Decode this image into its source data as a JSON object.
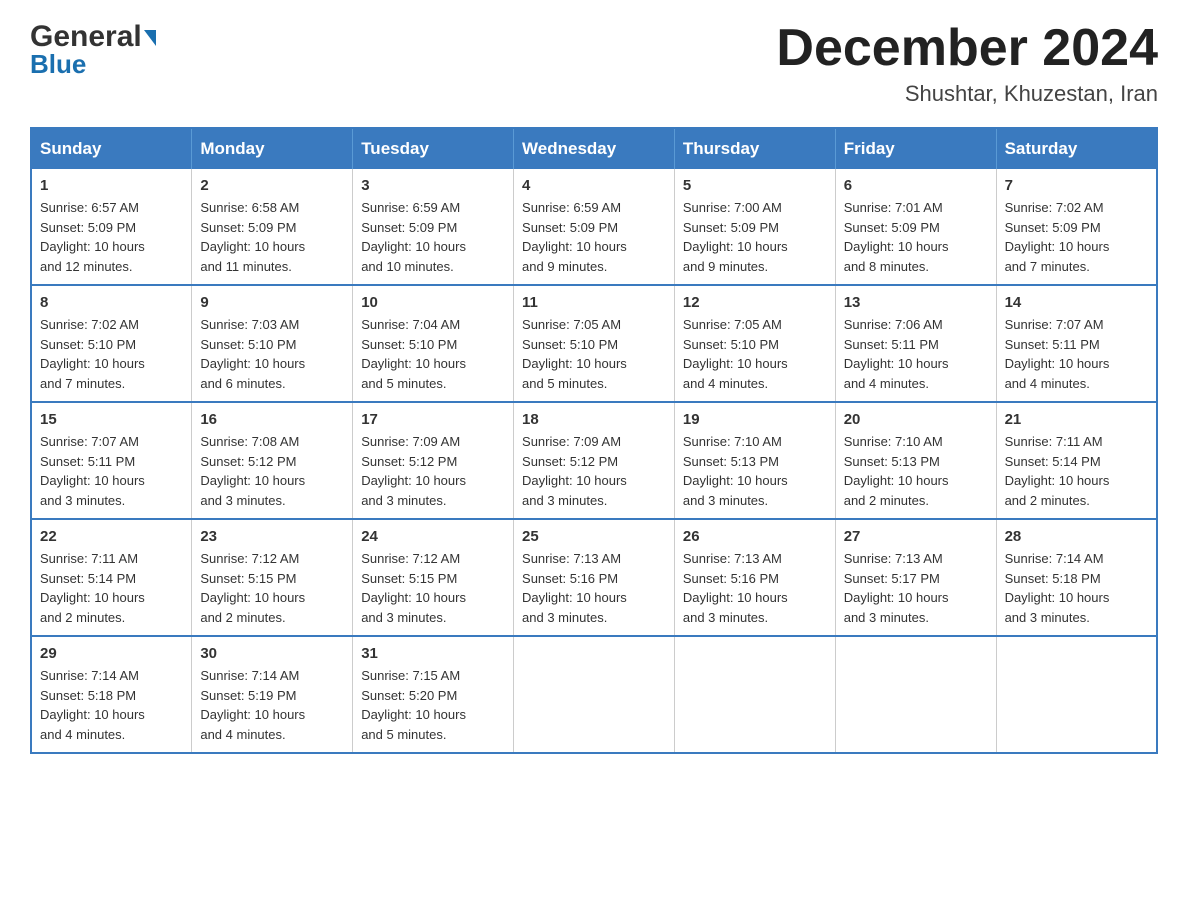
{
  "header": {
    "logo_line1": "General",
    "logo_line2": "Blue",
    "month": "December 2024",
    "location": "Shushtar, Khuzestan, Iran"
  },
  "weekdays": [
    "Sunday",
    "Monday",
    "Tuesday",
    "Wednesday",
    "Thursday",
    "Friday",
    "Saturday"
  ],
  "weeks": [
    [
      {
        "day": "1",
        "sunrise": "6:57 AM",
        "sunset": "5:09 PM",
        "daylight": "10 hours and 12 minutes."
      },
      {
        "day": "2",
        "sunrise": "6:58 AM",
        "sunset": "5:09 PM",
        "daylight": "10 hours and 11 minutes."
      },
      {
        "day": "3",
        "sunrise": "6:59 AM",
        "sunset": "5:09 PM",
        "daylight": "10 hours and 10 minutes."
      },
      {
        "day": "4",
        "sunrise": "6:59 AM",
        "sunset": "5:09 PM",
        "daylight": "10 hours and 9 minutes."
      },
      {
        "day": "5",
        "sunrise": "7:00 AM",
        "sunset": "5:09 PM",
        "daylight": "10 hours and 9 minutes."
      },
      {
        "day": "6",
        "sunrise": "7:01 AM",
        "sunset": "5:09 PM",
        "daylight": "10 hours and 8 minutes."
      },
      {
        "day": "7",
        "sunrise": "7:02 AM",
        "sunset": "5:09 PM",
        "daylight": "10 hours and 7 minutes."
      }
    ],
    [
      {
        "day": "8",
        "sunrise": "7:02 AM",
        "sunset": "5:10 PM",
        "daylight": "10 hours and 7 minutes."
      },
      {
        "day": "9",
        "sunrise": "7:03 AM",
        "sunset": "5:10 PM",
        "daylight": "10 hours and 6 minutes."
      },
      {
        "day": "10",
        "sunrise": "7:04 AM",
        "sunset": "5:10 PM",
        "daylight": "10 hours and 5 minutes."
      },
      {
        "day": "11",
        "sunrise": "7:05 AM",
        "sunset": "5:10 PM",
        "daylight": "10 hours and 5 minutes."
      },
      {
        "day": "12",
        "sunrise": "7:05 AM",
        "sunset": "5:10 PM",
        "daylight": "10 hours and 4 minutes."
      },
      {
        "day": "13",
        "sunrise": "7:06 AM",
        "sunset": "5:11 PM",
        "daylight": "10 hours and 4 minutes."
      },
      {
        "day": "14",
        "sunrise": "7:07 AM",
        "sunset": "5:11 PM",
        "daylight": "10 hours and 4 minutes."
      }
    ],
    [
      {
        "day": "15",
        "sunrise": "7:07 AM",
        "sunset": "5:11 PM",
        "daylight": "10 hours and 3 minutes."
      },
      {
        "day": "16",
        "sunrise": "7:08 AM",
        "sunset": "5:12 PM",
        "daylight": "10 hours and 3 minutes."
      },
      {
        "day": "17",
        "sunrise": "7:09 AM",
        "sunset": "5:12 PM",
        "daylight": "10 hours and 3 minutes."
      },
      {
        "day": "18",
        "sunrise": "7:09 AM",
        "sunset": "5:12 PM",
        "daylight": "10 hours and 3 minutes."
      },
      {
        "day": "19",
        "sunrise": "7:10 AM",
        "sunset": "5:13 PM",
        "daylight": "10 hours and 3 minutes."
      },
      {
        "day": "20",
        "sunrise": "7:10 AM",
        "sunset": "5:13 PM",
        "daylight": "10 hours and 2 minutes."
      },
      {
        "day": "21",
        "sunrise": "7:11 AM",
        "sunset": "5:14 PM",
        "daylight": "10 hours and 2 minutes."
      }
    ],
    [
      {
        "day": "22",
        "sunrise": "7:11 AM",
        "sunset": "5:14 PM",
        "daylight": "10 hours and 2 minutes."
      },
      {
        "day": "23",
        "sunrise": "7:12 AM",
        "sunset": "5:15 PM",
        "daylight": "10 hours and 2 minutes."
      },
      {
        "day": "24",
        "sunrise": "7:12 AM",
        "sunset": "5:15 PM",
        "daylight": "10 hours and 3 minutes."
      },
      {
        "day": "25",
        "sunrise": "7:13 AM",
        "sunset": "5:16 PM",
        "daylight": "10 hours and 3 minutes."
      },
      {
        "day": "26",
        "sunrise": "7:13 AM",
        "sunset": "5:16 PM",
        "daylight": "10 hours and 3 minutes."
      },
      {
        "day": "27",
        "sunrise": "7:13 AM",
        "sunset": "5:17 PM",
        "daylight": "10 hours and 3 minutes."
      },
      {
        "day": "28",
        "sunrise": "7:14 AM",
        "sunset": "5:18 PM",
        "daylight": "10 hours and 3 minutes."
      }
    ],
    [
      {
        "day": "29",
        "sunrise": "7:14 AM",
        "sunset": "5:18 PM",
        "daylight": "10 hours and 4 minutes."
      },
      {
        "day": "30",
        "sunrise": "7:14 AM",
        "sunset": "5:19 PM",
        "daylight": "10 hours and 4 minutes."
      },
      {
        "day": "31",
        "sunrise": "7:15 AM",
        "sunset": "5:20 PM",
        "daylight": "10 hours and 5 minutes."
      },
      null,
      null,
      null,
      null
    ]
  ],
  "labels": {
    "sunrise": "Sunrise:",
    "sunset": "Sunset:",
    "daylight": "Daylight:"
  }
}
